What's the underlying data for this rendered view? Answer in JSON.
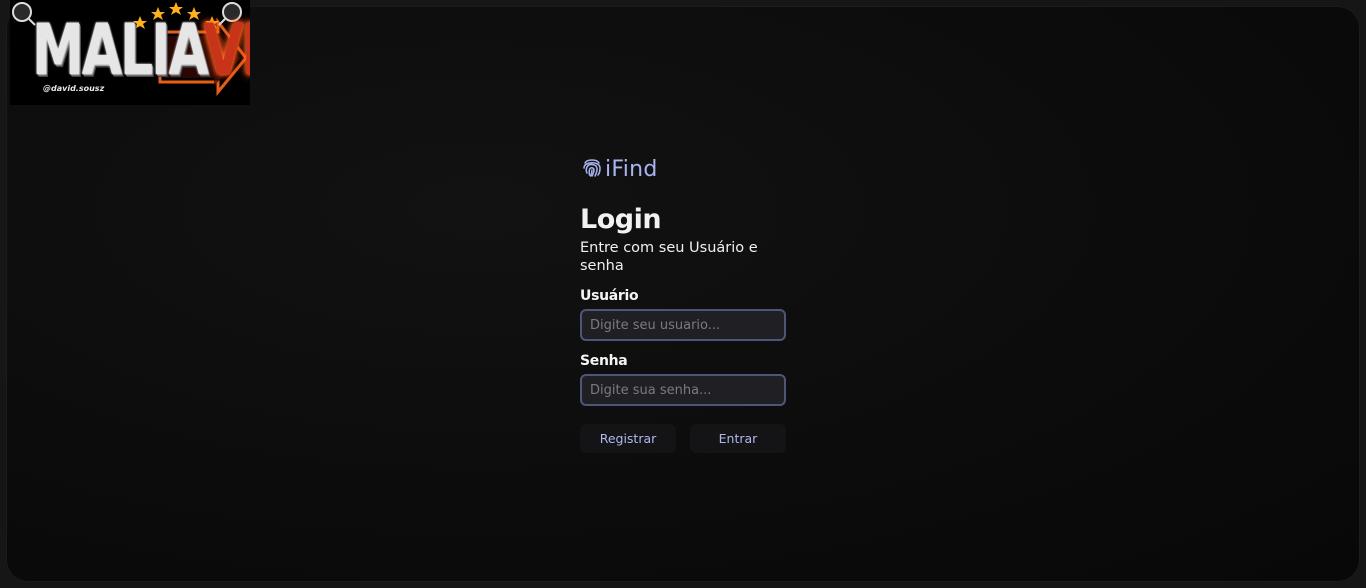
{
  "logo": {
    "text_main": "MALIA",
    "text_accent": "VIP",
    "handle": "@david.sousz"
  },
  "brand": {
    "icon": "fingerprint-icon",
    "name": "iFind",
    "color": "#a9b5f0"
  },
  "login": {
    "title": "Login",
    "subtitle": "Entre com seu Usuário e senha",
    "user_label": "Usuário",
    "user_placeholder": "Digite seu usuario...",
    "password_label": "Senha",
    "password_placeholder": "Digite sua senha...",
    "register_label": "Registrar",
    "submit_label": "Entrar"
  }
}
